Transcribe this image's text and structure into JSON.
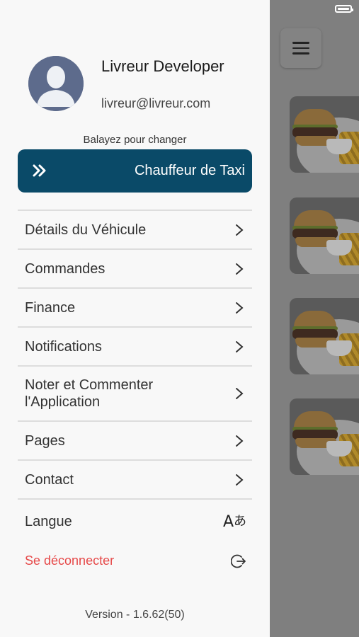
{
  "profile": {
    "name": "Livreur Developer",
    "email": "livreur@livreur.com"
  },
  "swipe": {
    "hint": "Balayez pour changer",
    "label": "Chauffeur de Taxi"
  },
  "menu": {
    "items": [
      {
        "label": "Détails du Véhicule"
      },
      {
        "label": "Commandes"
      },
      {
        "label": "Finance"
      },
      {
        "label": "Notifications"
      },
      {
        "label": "Noter et Commenter l'Application"
      },
      {
        "label": "Pages"
      },
      {
        "label": "Contact"
      }
    ],
    "language_label": "Langue",
    "language_icon": "translate-icon",
    "logout_label": "Se déconnecter",
    "logout_icon": "logout-icon"
  },
  "version": "Version - 1.6.62(50)",
  "colors": {
    "primary": "#0a4a68",
    "logout": "#e64848"
  }
}
